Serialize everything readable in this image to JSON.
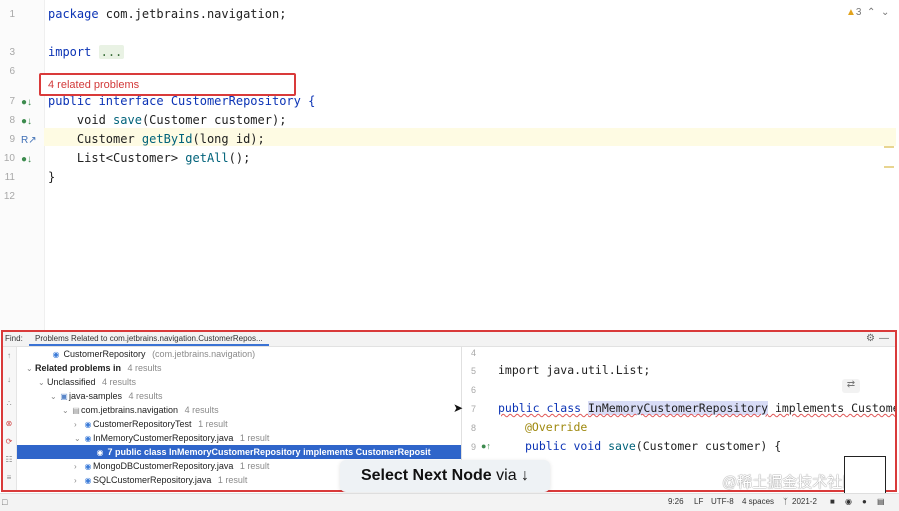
{
  "editor": {
    "line_numbers": [
      "1",
      "3",
      "6",
      "7",
      "8",
      "9",
      "10",
      "11",
      "12"
    ],
    "code": {
      "package_kw": "package",
      "package_name": " com.jetbrains.navigation;",
      "import_kw": "import",
      "import_fold": "...",
      "interface_line": "public interface CustomerRepository {",
      "save_pre": "    void ",
      "save_fn": "save",
      "save_post": "(Customer customer);",
      "getbyid_pre": "    Customer ",
      "getbyid_fn": "getById",
      "getbyid_post": "(long id);",
      "getall_pre": "    List<Customer> ",
      "getall_fn": "getAll",
      "getall_post": "();",
      "close_brace": "}"
    },
    "related_problems": "4 related problems",
    "warnings_count": "3",
    "accent": "#d93a3a"
  },
  "find": {
    "label": "Find:",
    "tab": "Problems Related to com.jetbrains.navigation.CustomerRepos...",
    "tree": {
      "root": "CustomerRepository",
      "root_pkg": "(com.jetbrains.navigation)",
      "related_label": "Related problems in",
      "related_count": "4 results",
      "unclassified": "Unclassified",
      "unclassified_count": "4 results",
      "module": "java-samples",
      "module_count": "4 results",
      "package": "com.jetbrains.navigation",
      "package_count": "4 results",
      "items": [
        {
          "name": "CustomerRepositoryTest",
          "count": "1 result"
        },
        {
          "name": "InMemoryCustomerRepository.java",
          "count": "1 result"
        },
        {
          "name": "7 public class InMemoryCustomerRepository implements CustomerReposit"
        },
        {
          "name": "MongoDBCustomerRepository.java",
          "count": "1 result"
        },
        {
          "name": "SQLCustomerRepository.java",
          "count": "1 result"
        }
      ]
    },
    "preview": {
      "line_numbers": [
        "4",
        "5",
        "6",
        "7",
        "8",
        "9"
      ],
      "import_line": "import java.util.List;",
      "class_kw": "public class ",
      "class_name": "InMemoryCustomerRepository",
      "class_rest": " implements CustomerRepository",
      "override": "@Override",
      "save_pre": "public void ",
      "save_fn": "save",
      "save_post": "(Customer customer) {"
    }
  },
  "hint": {
    "bold": "Select Next Node",
    "rest": " via ↓"
  },
  "watermark": {
    "text": "@稀土掘金技术社区"
  },
  "statusbar": {
    "position": "9:26",
    "line_sep": "LF",
    "encoding": "UTF-8",
    "indent": "4 spaces",
    "branch": "2021-2"
  }
}
